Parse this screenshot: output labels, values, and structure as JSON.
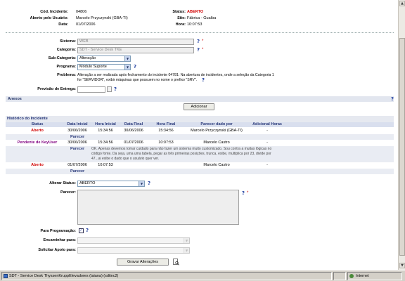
{
  "header": {
    "incident_label": "Cód. Incidente:",
    "incident_value": "04806",
    "opened_by_label": "Aberto pelo Usuário:",
    "opened_by_value": "Marcelo Przyczynski (GBA-TI)",
    "date_label": "Data:",
    "date_value": "01/07/2006",
    "status_label": "Status:",
    "status_value": "ABERTO",
    "site_label": "Site:",
    "site_value": "Fábrica - Guaíba",
    "time_label": "Hora:",
    "time_value": "10:07:53"
  },
  "form": {
    "sistema_label": "Sistema:",
    "sistema_value": "WEB",
    "categoria_label": "Categoria:",
    "categoria_value": "SDT - Service Desk TKE",
    "subcategoria_label": "Sub-Categoria:",
    "subcategoria_value": "Alteração",
    "programa_label": "Programa:",
    "programa_value": "Módulo Suporte",
    "problema_label": "Problema:",
    "problema_line1": "Alteração a ser realizada após fechamento do incidente 04781: Na abertura de incidentes, onde a seleção da Categoria 1",
    "problema_line2": "for \"SERVIDOR\", exibir máquinas que possuem no nome o prefixo \"SRV\".",
    "previsao_label_1": "Previsão de Entrega:",
    "previsao_value": "",
    "help_glyph": "?",
    "req_glyph": "*"
  },
  "anexos": {
    "title": "Anexos",
    "add_button": "Adicionar"
  },
  "historico": {
    "title": "Histórico do Incidente",
    "columns": [
      "Status",
      "Data Inicial",
      "Hora Inicial",
      "Data Final",
      "Hora Final",
      "Parecer dado por",
      "Adicional Horas"
    ],
    "parecer_label": "Parecer",
    "rows": [
      {
        "status": "Aberto",
        "data_ini": "30/06/2006",
        "hora_ini": "15:34:56",
        "data_fim": "30/06/2006",
        "hora_fim": "15:34:56",
        "por": "Marcelo Przyczynski (GBA-TI)",
        "adic": "-",
        "parecer": ""
      },
      {
        "status": "Pendente de KeyUser",
        "data_ini": "30/06/2006",
        "hora_ini": "15:34:56",
        "data_fim": "01/07/2006",
        "hora_fim": "10:07:53",
        "por": "Marcelo Castro",
        "adic": "-",
        "parecer_l1": "OK. Apenas devemos tomar cuidado para não fazer um sistema muito customizado. Sou contra a muitas lógicas no",
        "parecer_l2": "código fonte. Da seja, uma uma tabela, pegar as três primeiras posições, trunca, exibe, multiplica por 23, divide por",
        "parecer_l3": "47...ai exibe o dado que o usuário quer ver."
      },
      {
        "status": "Aberto",
        "data_ini": "01/07/2006",
        "hora_ini": "10:07:53",
        "data_fim": "",
        "hora_fim": "",
        "por": "Marcelo Castro",
        "adic": "-",
        "parecer": ""
      }
    ]
  },
  "bottom": {
    "alterar_status_label": "Alterar Status:",
    "alterar_status_value": "ABERTO",
    "parecer_label": "Parecer:",
    "programacao_label": "Para Programação:",
    "encaminhar_label": "Encaminhar para:",
    "solicitar_label": "Solicitar Apoio para:",
    "save_button": "Gravar Alterações"
  },
  "statusbar": {
    "title": "SDT - Service Desk ThyssenKruppElevadores   (taiana) (sdtinc2)",
    "zone": "Internet"
  },
  "colors": {
    "status_red": "#d00000",
    "status_purple": "#800080",
    "header_blue": "#2a3a7a"
  },
  "icons": {
    "help": "help-icon",
    "required": "required-asterisk-icon",
    "dropdown": "chevron-down-icon",
    "print": "print-preview-icon",
    "check": "checkmark-icon"
  }
}
